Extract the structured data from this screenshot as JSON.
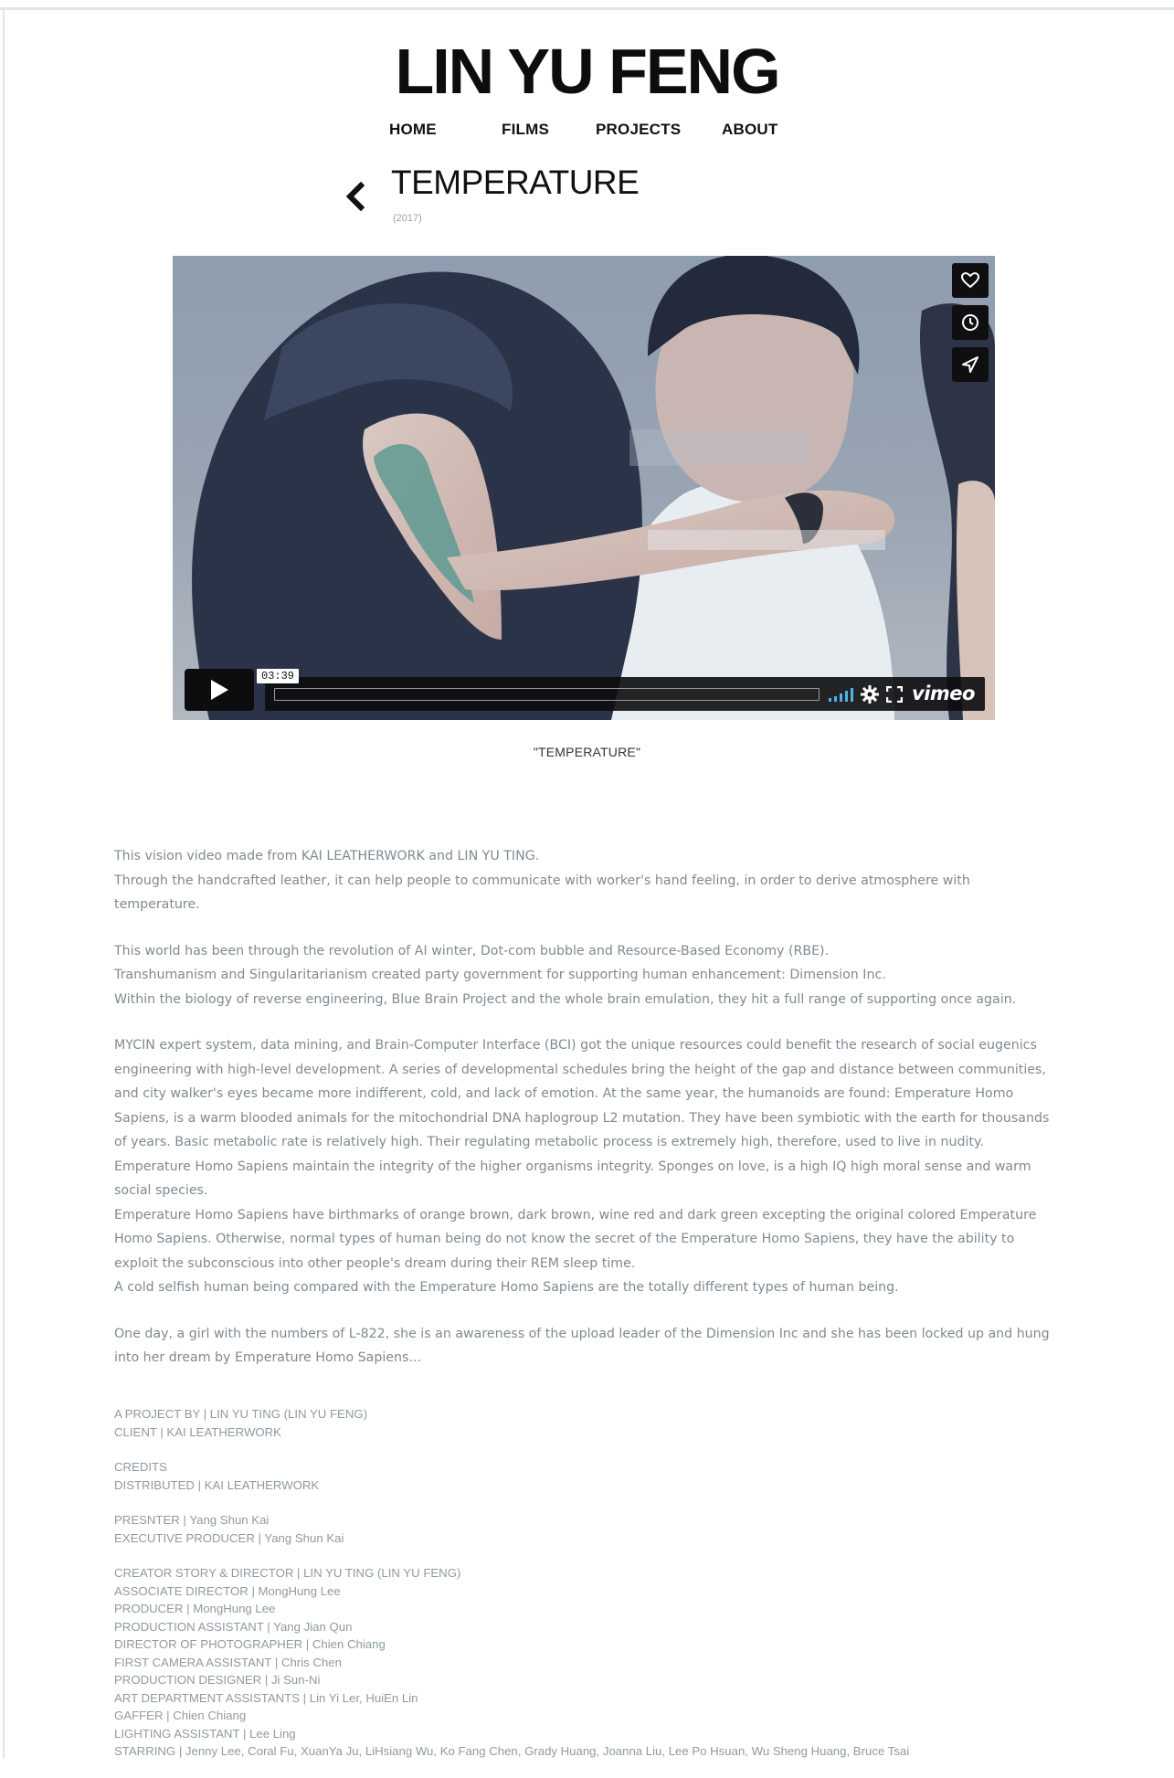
{
  "site": {
    "title": "LIN YU FENG",
    "nav": [
      {
        "label": "HOME"
      },
      {
        "label": "FILMS"
      },
      {
        "label": "PROJECTS"
      },
      {
        "label": "ABOUT"
      }
    ]
  },
  "page": {
    "title": "TEMPERATURE",
    "year": "(2017)"
  },
  "video": {
    "timecode": "03:39",
    "progress": 0,
    "brand": "vimeo",
    "caption": "\"TEMPERATURE\"",
    "side_buttons": [
      "heart-icon",
      "clock-icon",
      "send-icon"
    ],
    "controls": [
      "volume-icon",
      "settings-icon",
      "fullscreen-icon"
    ]
  },
  "description": [
    [
      "This vision video made from KAI LEATHERWORK and LIN YU TING.",
      "Through the handcrafted leather, it can help people to communicate with worker's hand feeling, in order to derive atmosphere with temperature."
    ],
    [
      "This world has been through the revolution of  AI winter, Dot-com bubble and  Resource-Based Economy (RBE).",
      "Transhumanism and Singularitarianism created party government for supporting human enhancement: Dimension Inc.",
      "Within the biology of reverse engineering, Blue Brain Project and the whole brain emulation, they hit a full range of supporting once again."
    ],
    [
      "MYCIN expert system, data mining, and Brain-Computer Interface (BCI) got the unique resources could benefit the research of social eugenics engineering with high-level development. A series of developmental schedules bring the height of the gap and distance between communities, and city walker's eyes became more indifferent, cold, and lack of emotion. At the same year, the humanoids are found: Emperature Homo Sapiens, is a warm blooded animals for the mitochondrial DNA haplogroup L2 mutation. They have been symbiotic with the earth for thousands of years. Basic metabolic rate is relatively high. Their regulating metabolic process is extremely high, therefore, used to live in nudity. Emperature Homo Sapiens maintain the integrity of the higher organisms integrity. Sponges on love, is a high IQ high moral sense and warm social species.",
      "Emperature Homo Sapiens have birthmarks of orange brown, dark brown, wine red and dark green excepting the original colored Emperature Homo Sapiens. Otherwise, normal types of human being do not know the secret of the Emperature Homo Sapiens, they have the ability to exploit the subconscious into other people's dream during their REM sleep time.",
      "A cold selfish human being compared with the Emperature Homo Sapiens are the totally different types of human being."
    ],
    [
      "One day, a girl with the numbers of L-822, she is an awareness of the upload leader of the  Dimension Inc and she has been locked up and hung into her dream by Emperature Homo Sapiens..."
    ]
  ],
  "credits": [
    [
      "A PROJECT BY |  LIN YU TING (LIN YU FENG)",
      "CLIENT | KAI LEATHERWORK"
    ],
    [
      "CREDITS",
      "DISTRIBUTED | KAI LEATHERWORK"
    ],
    [
      "PRESNTER | Yang Shun Kai",
      "EXECUTIVE PRODUCER | Yang Shun Kai"
    ],
    [
      "CREATOR STORY & DIRECTOR | LIN YU TING (LIN YU FENG)",
      "ASSOCIATE DIRECTOR | MongHung Lee",
      "PRODUCER | MongHung Lee",
      "PRODUCTION ASSISTANT | Yang Jian Qun",
      "DIRECTOR OF PHOTOGRAPHER | Chien Chiang",
      "FIRST CAMERA ASSISTANT | Chris Chen",
      "PRODUCTION DESIGNER | Ji Sun-Ni",
      "ART DEPARTMENT ASSISTANTS | Lin Yi Ler, HuiEn Lin",
      "GAFFER | Chien Chiang",
      "LIGHTING ASSISTANT | Lee Ling",
      "STARRING | Jenny Lee, Coral Fu, XuanYa Ju, LiHsiang Wu, Ko Fang Chen, Grady Huang, Joanna Liu, Lee Po Hsuan, Wu Sheng Huang, Bruce Tsai"
    ]
  ]
}
